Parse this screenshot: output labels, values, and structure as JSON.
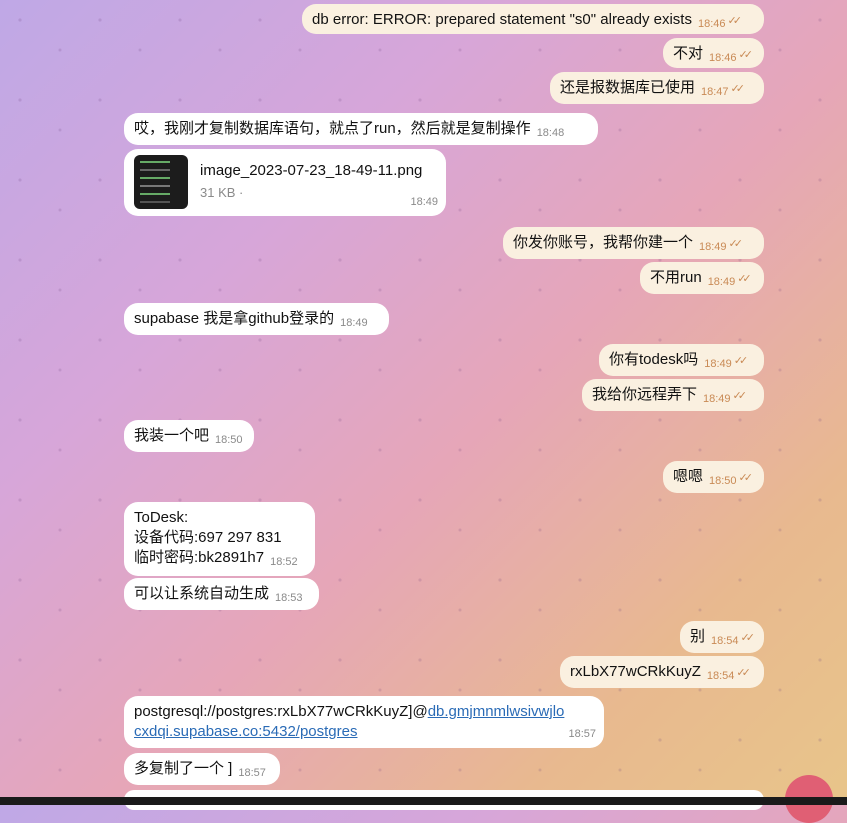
{
  "messages": [
    {
      "dir": "out",
      "text": "db error: ERROR: prepared statement \"s0\" already exists",
      "time": "18:46"
    },
    {
      "dir": "out",
      "text": "不对",
      "time": "18:46"
    },
    {
      "dir": "out",
      "text": "还是报数据库已使用",
      "time": "18:47"
    },
    {
      "dir": "in",
      "text": "哎，我刚才复制数据库语句，就点了run，然后就是复制操作",
      "time": "18:48"
    },
    {
      "dir": "in",
      "type": "file",
      "file_name": "image_2023-07-23_18-49-11.png",
      "file_size": "31 KB ·",
      "time": "18:49"
    },
    {
      "dir": "out",
      "text": "你发你账号，我帮你建一个",
      "time": "18:49"
    },
    {
      "dir": "out",
      "text": "不用run",
      "time": "18:49"
    },
    {
      "dir": "in",
      "text": "supabase 我是拿github登录的",
      "time": "18:49"
    },
    {
      "dir": "out",
      "text": "你有todesk吗",
      "time": "18:49"
    },
    {
      "dir": "out",
      "text": "我给你远程弄下",
      "time": "18:49"
    },
    {
      "dir": "in",
      "text": "我装一个吧",
      "time": "18:50"
    },
    {
      "dir": "out",
      "text": "嗯嗯",
      "time": "18:50"
    },
    {
      "dir": "in",
      "lines": [
        "ToDesk:",
        "设备代码:697 297 831",
        "临时密码:bk2891h7"
      ],
      "time": "18:52"
    },
    {
      "dir": "in",
      "text": "可以让系统自动生成",
      "time": "18:53"
    },
    {
      "dir": "out",
      "text": "别",
      "time": "18:54"
    },
    {
      "dir": "out",
      "text": "rxLbX77wCRkKuyZ",
      "time": "18:54"
    },
    {
      "dir": "in",
      "type": "link",
      "prefix": "postgresql://postgres:rxLbX77wCRkKuyZ]@",
      "link_line1": "db.gmjmnmlwsivwjlo",
      "link_line2": "cxdqi.supabase.co:5432/postgres",
      "time": "18:57"
    },
    {
      "dir": "in",
      "text": "多复制了一个 ]",
      "time": "18:57"
    }
  ],
  "read_mark": "✓✓"
}
